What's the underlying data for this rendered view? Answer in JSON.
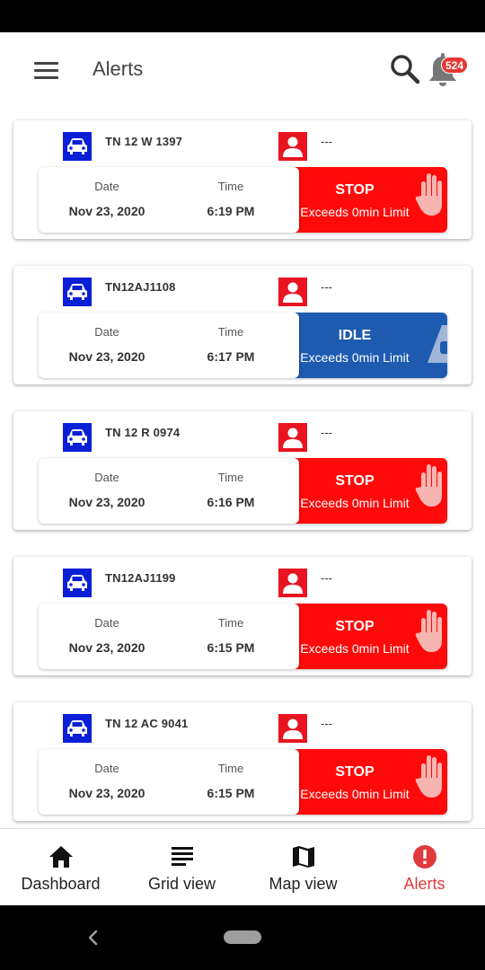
{
  "app_bar": {
    "title": "Alerts",
    "notification_count": "524"
  },
  "alerts": [
    {
      "vehicle": "TN 12 W 1397",
      "driver": "---",
      "date_label": "Date",
      "date": "Nov 23, 2020",
      "time_label": "Time",
      "time": "6:19 PM",
      "status": "STOP",
      "description": "Exceeds 0min Limit",
      "type": "stop"
    },
    {
      "vehicle": "TN12AJ1108",
      "driver": "---",
      "date_label": "Date",
      "date": "Nov 23, 2020",
      "time_label": "Time",
      "time": "6:17 PM",
      "status": "IDLE",
      "description": "Exceeds 0min Limit",
      "type": "idle"
    },
    {
      "vehicle": "TN 12 R 0974",
      "driver": "---",
      "date_label": "Date",
      "date": "Nov 23, 2020",
      "time_label": "Time",
      "time": "6:16 PM",
      "status": "STOP",
      "description": "Exceeds 0min Limit",
      "type": "stop"
    },
    {
      "vehicle": "TN12AJ1199",
      "driver": "---",
      "date_label": "Date",
      "date": "Nov 23, 2020",
      "time_label": "Time",
      "time": "6:15 PM",
      "status": "STOP",
      "description": "Exceeds 0min Limit",
      "type": "stop"
    },
    {
      "vehicle": "TN 12 AC 9041",
      "driver": "---",
      "date_label": "Date",
      "date": "Nov 23, 2020",
      "time_label": "Time",
      "time": "6:15 PM",
      "status": "STOP",
      "description": "Exceeds 0min Limit",
      "type": "stop"
    }
  ],
  "bottom_nav": {
    "items": [
      {
        "label": "Dashboard",
        "icon": "home-icon"
      },
      {
        "label": "Grid view",
        "icon": "list-icon"
      },
      {
        "label": "Map view",
        "icon": "map-icon"
      },
      {
        "label": "Alerts",
        "icon": "alert-icon",
        "active": true
      }
    ]
  },
  "colors": {
    "stop": "#ff0a0a",
    "idle": "#1e5bb0",
    "vehicle_icon_bg": "#0a1fd6",
    "driver_icon_bg": "#e8141f",
    "active_nav": "#e0393e",
    "badge": "#e53935"
  }
}
